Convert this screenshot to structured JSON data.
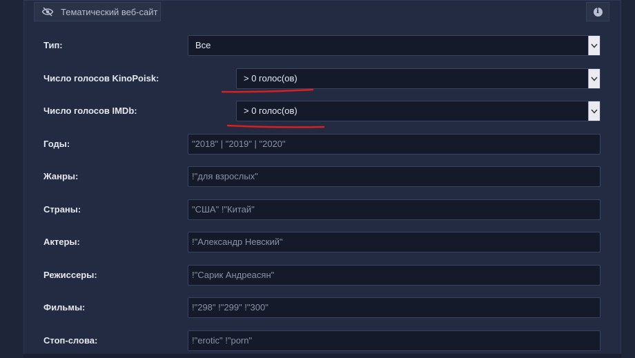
{
  "panel": {
    "title": "Тематический веб-сайт",
    "info_icon_glyph": "i"
  },
  "filters": {
    "type": {
      "label": "Тип:",
      "value": "Все"
    },
    "kp_votes": {
      "label": "Число голосов KinoPoisk:",
      "value": "> 0 голос(ов)"
    },
    "imdb_votes": {
      "label": "Число голосов IMDb:",
      "value": "> 0 голос(ов)"
    },
    "years": {
      "label": "Годы:",
      "placeholder": "\"2018\" | \"2019\" | \"2020\""
    },
    "genres": {
      "label": "Жанры:",
      "placeholder": "!\"для взрослых\""
    },
    "countries": {
      "label": "Страны:",
      "placeholder": "\"США\" !\"Китай\""
    },
    "actors": {
      "label": "Актеры:",
      "placeholder": "!\"Александр Невский\""
    },
    "directors": {
      "label": "Режиссеры:",
      "placeholder": "!\"Сарик Андреасян\""
    },
    "films": {
      "label": "Фильмы:",
      "placeholder": "!\"298\" !\"299\" !\"300\""
    },
    "stopwords": {
      "label": "Стоп-слова:",
      "placeholder": "!\"erotic\" !\"porn\""
    }
  },
  "colors": {
    "background": "#1b2134",
    "panel": "#232b42",
    "field": "#151a2b",
    "annotation": "#d91f1f"
  },
  "icons": {
    "header": "eye-off-icon",
    "info": "info-icon",
    "dropdown": "chevron-down-icon"
  }
}
